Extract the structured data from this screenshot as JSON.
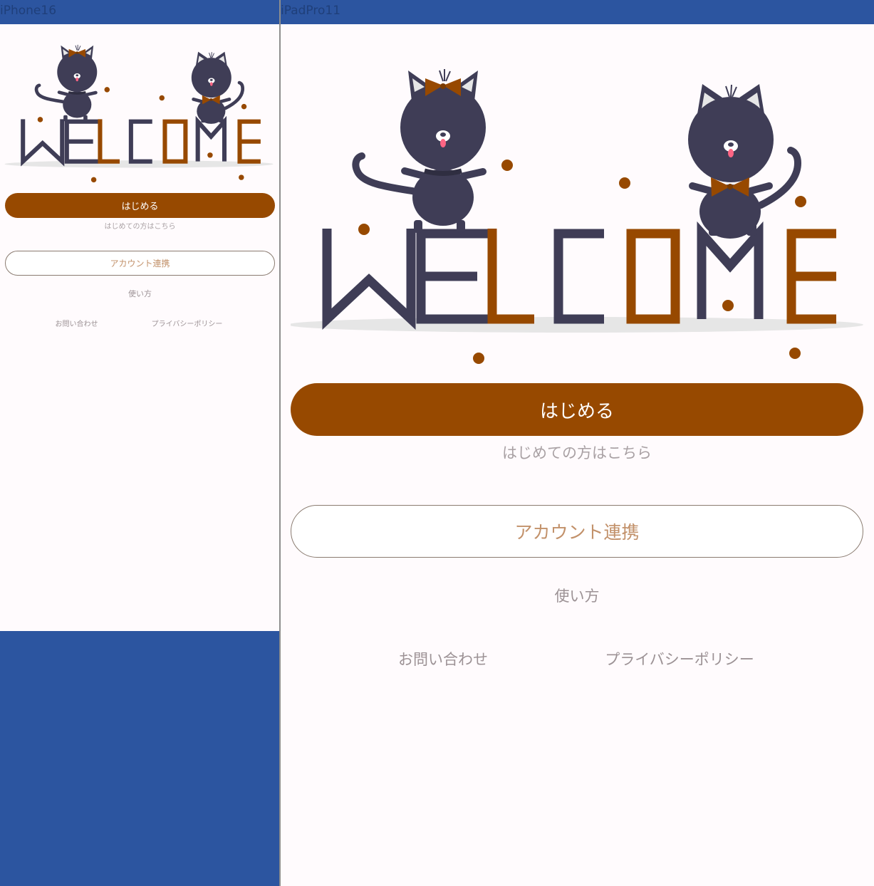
{
  "devices": [
    {
      "id": "phone",
      "label": "iPhone16"
    },
    {
      "id": "pad",
      "label": "iPadPro11"
    }
  ],
  "app": {
    "hero_word": "WELCOME",
    "hero_letters": [
      "W",
      "E",
      "L",
      "C",
      "O",
      "M",
      "E"
    ],
    "start_button": "はじめる",
    "start_note": "はじめての方はこちら",
    "link_button": "アカウント連携",
    "how_to_use": "使い方",
    "contact": "お問い合わせ",
    "privacy": "プライバシーポリシー"
  },
  "colors": {
    "page_background": "#2c55a0",
    "screen_background": "#fffbfd",
    "accent_brown": "#974900",
    "cat_dark": "#3f3d56",
    "outline_text": "#c2916a",
    "muted_text": "#9c9295"
  },
  "icons": [
    "cat-with-bow-illustration",
    "cat-with-bowtie-illustration",
    "welcome-illustration"
  ]
}
